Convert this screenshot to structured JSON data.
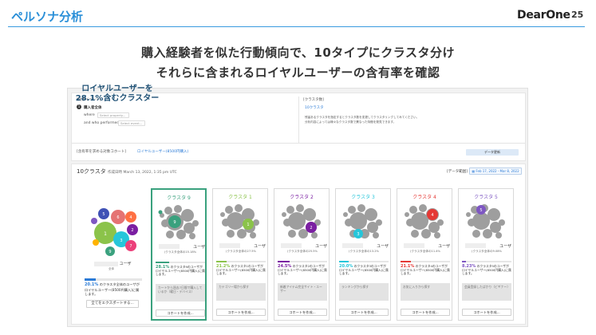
{
  "slide": {
    "title": "ペルソナ分析",
    "brand": "DearOne",
    "page_number": "25",
    "headline_1": "購入経験者を似た行動傾向で、10タイプにクラスタ分け",
    "headline_2": "それらに含まれるロイヤルユーザーの含有率を確認",
    "accent_color": "#2a8fd8"
  },
  "callout": {
    "line1": "ロイヤルユーザーを",
    "line2": "28.1%含むクラスター"
  },
  "app": {
    "target_event_label": "[対象イベント]",
    "target_event_step": "1",
    "target_event_name": "購入者全体",
    "where_label": "where",
    "where_placeholder": "Select property...",
    "performed_label": "and who performed",
    "performed_placeholder": "Select event...",
    "cluster_count_label": "[クラスタ数]",
    "cluster_count_value": "10クラスタ",
    "cluster_note_1": "残留あるクラスタを指定するとクラスタ数を変更してクラスタリングしてみてください。",
    "cluster_note_2": "分析内容によっては様々なクラスタ数で異なった特徴を発見できます。",
    "cohort_label": "[含有率を求める対象コホート]",
    "cohort_value": "ロイヤルユーザー(8500円購入)",
    "run_button": "データ更新",
    "cluster_heading": "10クラスタ",
    "created_at": "作成日時 March 13, 2022, 1:35 pm UTC",
    "date_range_label": "[データ範囲]",
    "date_range_value": "Feb 17, 2022 - Mar 8, 2022",
    "overall": {
      "users_label": "ユーザ",
      "sub_label": "全体",
      "pct": "20.1%",
      "desc": "のクラスタ全体のユーザがロイヤルユーザー(8500円購入)に属します。",
      "export_button": "全てをエクスポートする..."
    }
  },
  "clusters": [
    {
      "title": "クラスタ 9",
      "color": "#3aa17e",
      "num": "9",
      "users": "ユーザ",
      "sub": "(クラスタ全体の15.18%",
      "pct": "28.1%",
      "desc": "のクラスタ9のユーザがロイヤルユーザー(8500円購入)に属します。",
      "tag": "カートから過去7日間で購入しているか（曜日・デバイス）",
      "button": "コホートを作成..."
    },
    {
      "title": "クラスタ 1",
      "color": "#8bc34a",
      "num": "1",
      "users": "ユーザ",
      "sub": "(クラスタ全体の27.5%",
      "pct": "21.2%",
      "desc": "のクラスタ1のユーザがロイヤルユーザー(8500円購入)に属します。",
      "tag": "カテゴリー場から探す",
      "button": "コホートを作成..."
    },
    {
      "title": "クラスタ 2",
      "color": "#7b1fa2",
      "num": "2",
      "users": "ユーザ",
      "sub": "(クラスタ全体の25.5%",
      "pct": "24.5%",
      "desc": "のクラスタ2のユーザがロイヤルユーザー(8500円購入)に属します。",
      "tag": "新着アイテム完全サイト・ユーザー",
      "button": "コホートを作成..."
    },
    {
      "title": "クラスタ 3",
      "color": "#26c6da",
      "num": "3",
      "users": "ユーザ",
      "sub": "(クラスタ全体の13.2%",
      "pct": "20.0%",
      "desc": "のクラスタ3のユーザがロイヤルユーザー(8500円購入)に属します。",
      "tag": "ランキングから探す",
      "button": "コホートを作成..."
    },
    {
      "title": "クラスタ 4",
      "color": "#e53935",
      "num": "4",
      "users": "ユーザ",
      "sub": "(クラスタ全体の11.4%",
      "pct": "21.1%",
      "desc": "のクラスタ4のユーザがロイヤルユーザー(8500円購入)に属します。",
      "tag": "お気に入りから探す",
      "button": "コホートを作成..."
    },
    {
      "title": "クラスタ 5",
      "color": "#7e57c2",
      "num": "5",
      "users": "ユーザ",
      "sub": "(クラスタ全体の9.08%",
      "pct": "8.23%",
      "desc": "のクラスタ5のユーザがロイヤルユーザー(8500円購入)に属します。",
      "tag": "会員登録したばかり（ビギナー）",
      "button": "コホートを作成..."
    }
  ]
}
